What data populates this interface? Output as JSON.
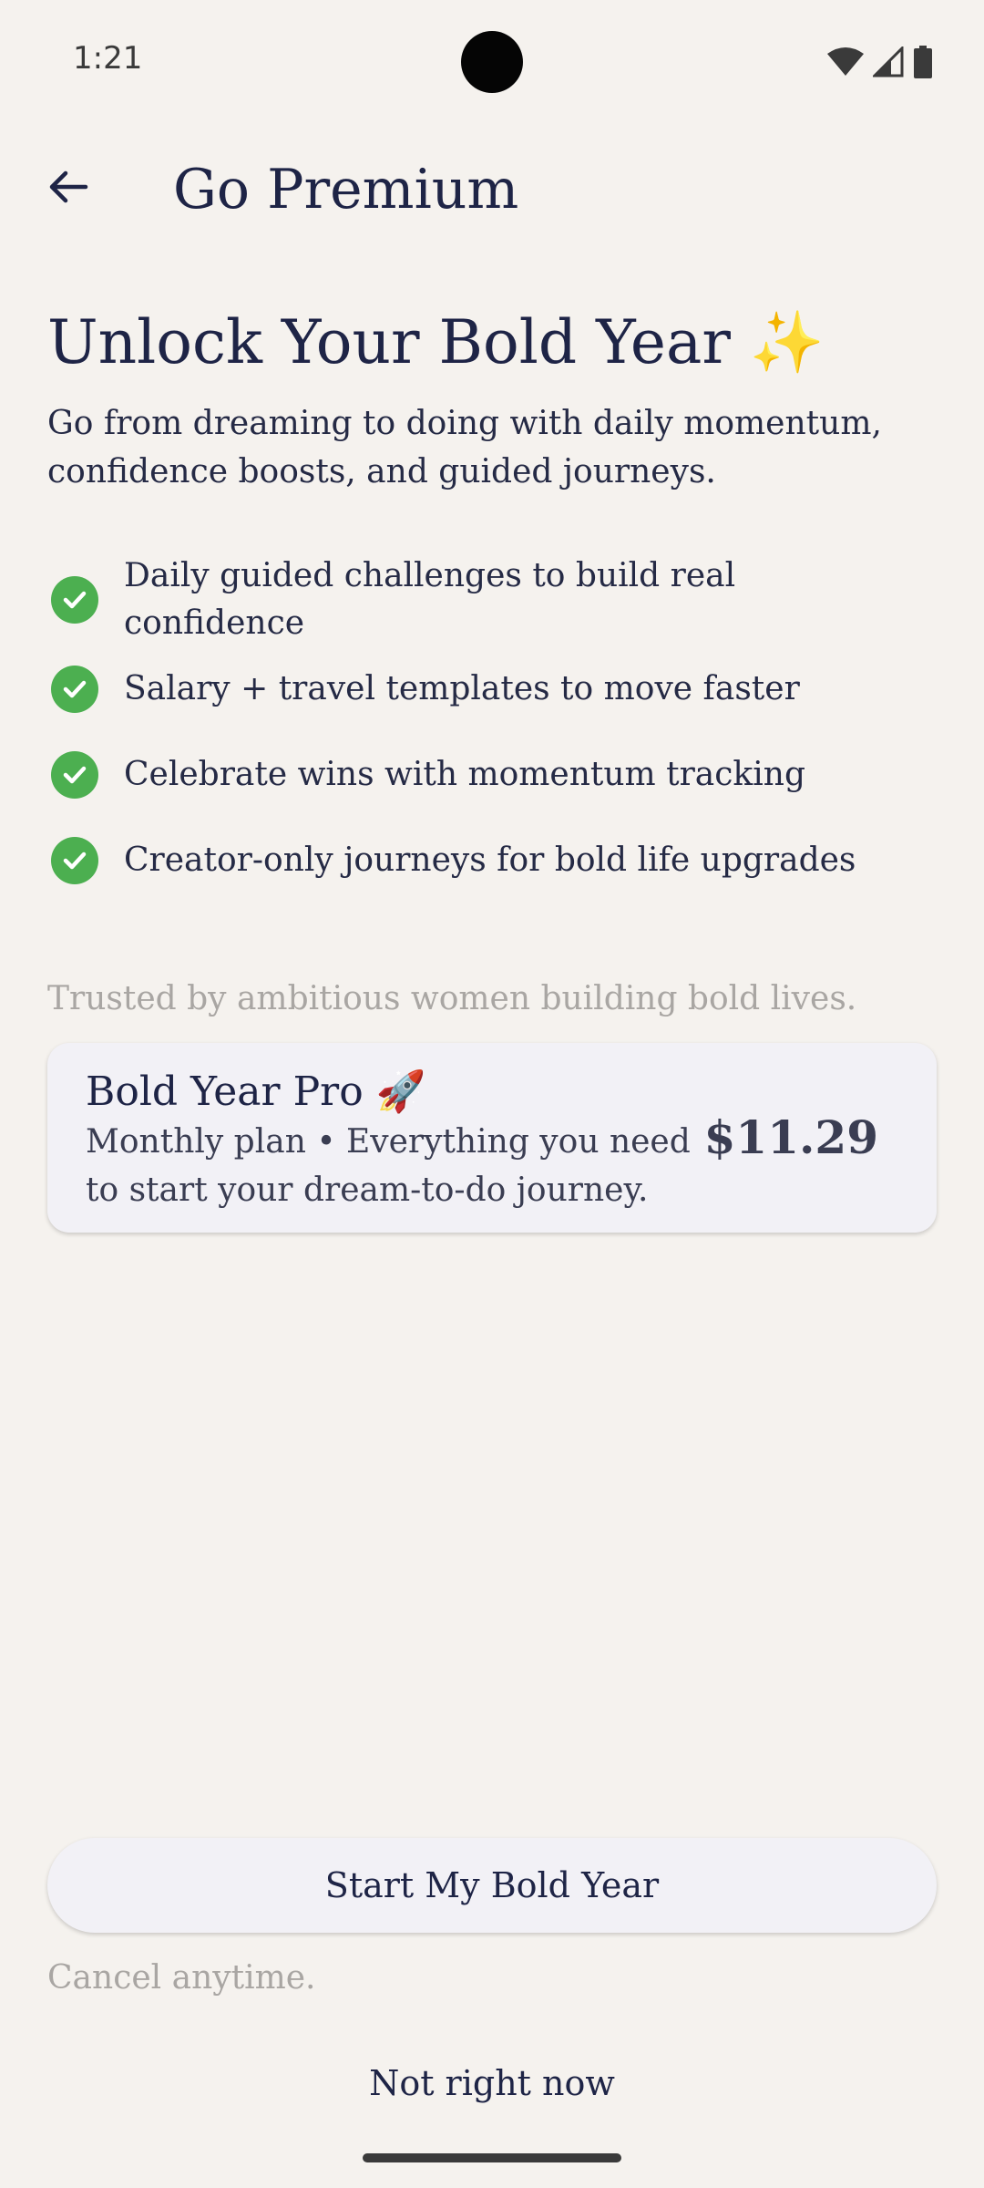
{
  "status_bar": {
    "time": "1:21",
    "icons": [
      "wifi-icon",
      "cell-signal-icon",
      "battery-icon"
    ]
  },
  "app_bar": {
    "back_icon": "arrow-back-icon",
    "title": "Go Premium"
  },
  "hero": {
    "title": "Unlock Your Bold Year ✨",
    "subtitle": "Go from dreaming to doing with daily momentum, confidence boosts, and guided journeys."
  },
  "features": [
    {
      "icon": "check-circle-icon",
      "text": "Daily guided challenges to build real confidence"
    },
    {
      "icon": "check-circle-icon",
      "text": "Salary + travel templates to move faster"
    },
    {
      "icon": "check-circle-icon",
      "text": "Celebrate wins with momentum tracking"
    },
    {
      "icon": "check-circle-icon",
      "text": "Creator-only journeys for bold life upgrades"
    }
  ],
  "trust_note": "Trusted by ambitious women building bold lives.",
  "plan": {
    "name": "Bold Year Pro 🚀",
    "description": "Monthly plan • Everything you need to start your dream-to-do journey.",
    "price": "$11.29"
  },
  "cta": {
    "primary_label": "Start My Bold Year",
    "cancel_note": "Cancel anytime.",
    "secondary_label": "Not right now"
  },
  "colors": {
    "background": "#f5f2ee",
    "text": "#1e2446",
    "muted": "#a9a6a3",
    "check": "#4caf50",
    "card": "#f2f1f6"
  }
}
